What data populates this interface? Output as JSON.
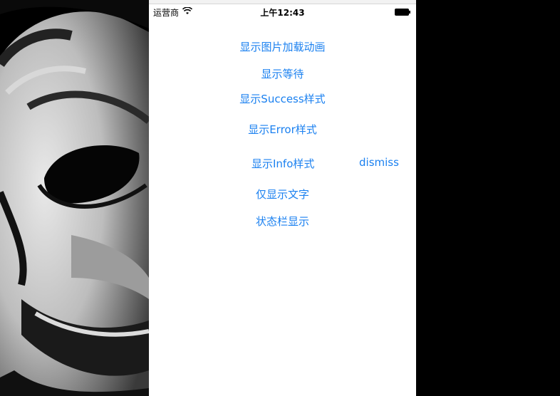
{
  "status_bar": {
    "carrier": "运营商",
    "time": "上午12:43",
    "wifi_icon": "wifi-icon",
    "battery_icon": "battery-icon"
  },
  "buttons": {
    "show_image_animation": "显示图片加载动画",
    "show_wait": "显示等待",
    "show_success": "显示Success样式",
    "show_error": "显示Error样式",
    "show_info": "显示Info样式",
    "dismiss": "dismiss",
    "show_text_only": "仅显示文字",
    "statusbar_show": "状态栏显示"
  },
  "colors": {
    "button_blue": "#1a80f0",
    "screen_bg": "#ffffff",
    "outer_bg": "#000000"
  }
}
